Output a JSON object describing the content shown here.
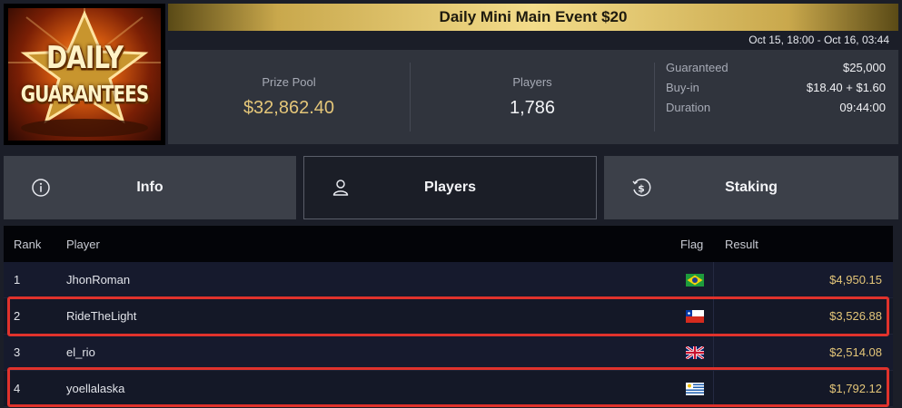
{
  "logo": {
    "line1": "DAILY",
    "line2": "GUARANTEES"
  },
  "event": {
    "title": "Daily Mini Main Event $20",
    "date_range": "Oct 15, 18:00 - Oct 16, 03:44"
  },
  "stats": {
    "prize_pool_label": "Prize Pool",
    "prize_pool_value": "$32,862.40",
    "players_label": "Players",
    "players_value": "1,786",
    "details": [
      {
        "label": "Guaranteed",
        "value": "$25,000"
      },
      {
        "label": "Buy-in",
        "value": "$18.40 + $1.60"
      },
      {
        "label": "Duration",
        "value": "09:44:00"
      }
    ]
  },
  "tabs": [
    {
      "label": "Info",
      "icon": "info-icon",
      "active": false
    },
    {
      "label": "Players",
      "icon": "user-icon",
      "active": true
    },
    {
      "label": "Staking",
      "icon": "dollar-coin-icon",
      "active": false
    }
  ],
  "table": {
    "headers": {
      "rank": "Rank",
      "player": "Player",
      "flag": "Flag",
      "result": "Result"
    },
    "rows": [
      {
        "rank": "1",
        "player": "JhonRoman",
        "flag": "brazil-flag",
        "result": "$4,950.15",
        "highlighted": false
      },
      {
        "rank": "2",
        "player": "RideTheLight",
        "flag": "chile-flag",
        "result": "$3,526.88",
        "highlighted": true
      },
      {
        "rank": "3",
        "player": "el_rio",
        "flag": "uk-flag",
        "result": "$2,514.08",
        "highlighted": false
      },
      {
        "rank": "4",
        "player": "yoellalaska",
        "flag": "uruguay-flag",
        "result": "$1,792.12",
        "highlighted": true
      }
    ]
  },
  "colors": {
    "accent_gold": "#e4c679",
    "highlight_red": "#e0322c",
    "active_tab_bg": "#1b1e27"
  }
}
